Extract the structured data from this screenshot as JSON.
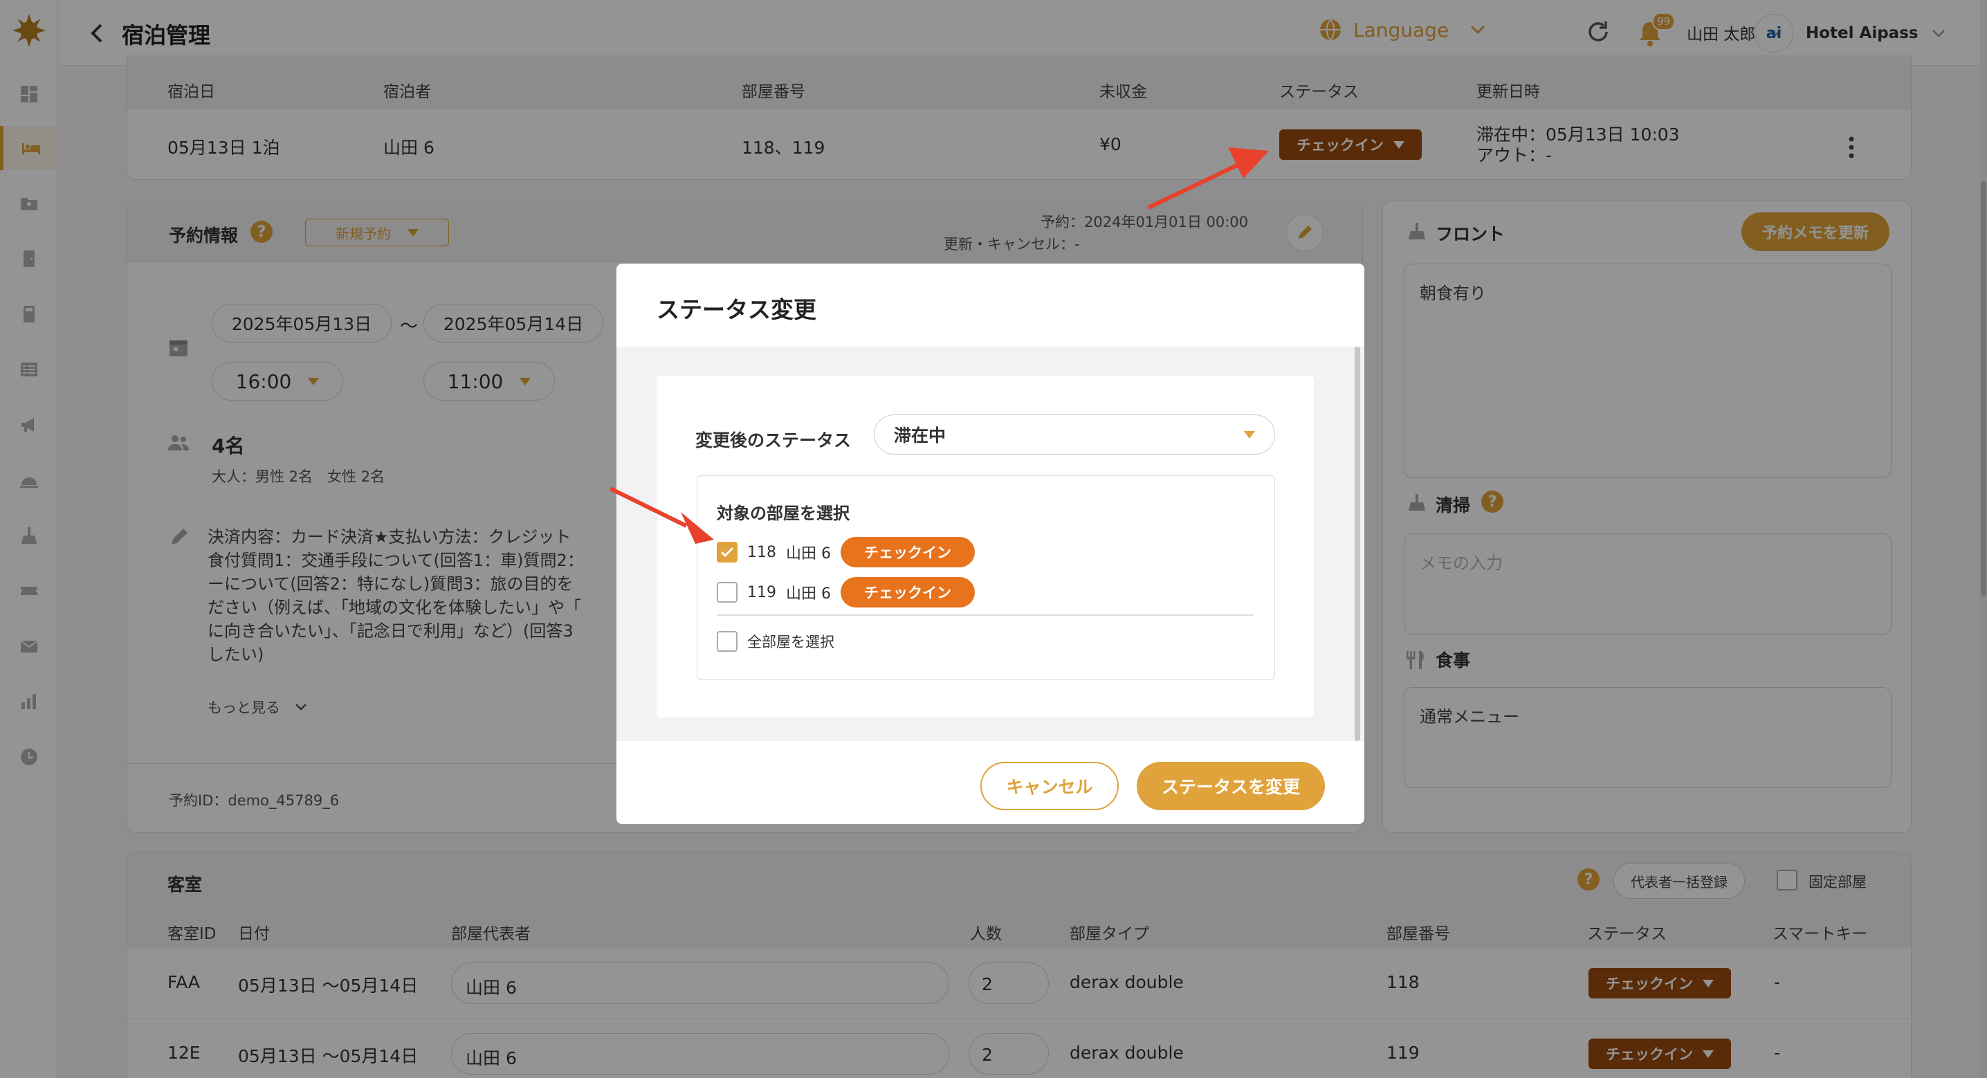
{
  "header": {
    "title": "宿泊管理",
    "language": "Language",
    "notif_count": "99",
    "user": "山田 太郎",
    "hotel": "Hotel Aipass",
    "hotel_logo": "ai"
  },
  "summary": {
    "headers": [
      "宿泊日",
      "宿泊者",
      "部屋番号",
      "未収金",
      "ステータス",
      "更新日時"
    ],
    "date": "05月13日 1泊",
    "guest": "山田 6",
    "rooms": "118、119",
    "unpaid": "¥0",
    "status": "チェックイン",
    "update_line1": "滞在中：05月13日 10:03",
    "update_line2": "アウト：-"
  },
  "reservation": {
    "title": "予約情報",
    "type": "新規予約",
    "reserved_at": "予約：2024年01月01日 00:00",
    "updated_at": "更新・キャンセル：-",
    "checkin_date": "2025年05月13日",
    "tilde": "～",
    "checkout_date": "2025年05月14日",
    "checkin_time": "16:00",
    "checkout_time": "11:00",
    "guests": "4名",
    "guests_detail": "大人：男性 2名　女性 2名",
    "note_lines": [
      "決済内容：カード決済★支払い方法：クレジット",
      "食付質問1：交通手段について(回答1：車)質問2：",
      "ーについて(回答2：特になし)質問3：旅の目的を",
      "ださい（例えば、「地域の文化を体験したい」や「",
      "に向き合いたい」、「記念日で利用」など）(回答3",
      "したい)"
    ],
    "more": "もっと見る",
    "id": "予約ID：demo_45789_6"
  },
  "right_panel": {
    "front_title": "フロント",
    "memo_button": "予約メモを更新",
    "front_memo": "朝食有り",
    "cleaning_title": "清掃",
    "cleaning_placeholder": "メモの入力",
    "meal_title": "食事",
    "meal_memo": "通常メニュー"
  },
  "rooms_section": {
    "title": "客室",
    "bulk_button": "代表者一括登録",
    "fixed_label": "固定部屋",
    "headers": [
      "客室ID",
      "日付",
      "部屋代表者",
      "人数",
      "部屋タイプ",
      "部屋番号",
      "ステータス",
      "スマートキー"
    ],
    "rows": [
      {
        "id": "FAA",
        "date": "05月13日 ～05月14日",
        "rep": "山田 6",
        "count": "2",
        "type": "derax double",
        "number": "118",
        "status": "チェックイン",
        "key": "-"
      },
      {
        "id": "12E",
        "date": "05月13日 ～05月14日",
        "rep": "山田 6",
        "count": "2",
        "type": "derax double",
        "number": "119",
        "status": "チェックイン",
        "key": "-"
      }
    ]
  },
  "modal": {
    "title": "ステータス変更",
    "status_label": "変更後のステータス",
    "status_value": "滞在中",
    "rooms_title": "対象の部屋を選択",
    "rooms": [
      {
        "number": "118",
        "name": "山田 6",
        "status": "チェックイン",
        "checked": true
      },
      {
        "number": "119",
        "name": "山田 6",
        "status": "チェックイン",
        "checked": false
      }
    ],
    "select_all": "全部屋を選択",
    "cancel": "キャンセル",
    "submit": "ステータスを変更"
  },
  "colors": {
    "accent": "#e0a23a",
    "brown": "#9c4a10",
    "orange": "#e8731d",
    "arrow": "#e8412c"
  }
}
